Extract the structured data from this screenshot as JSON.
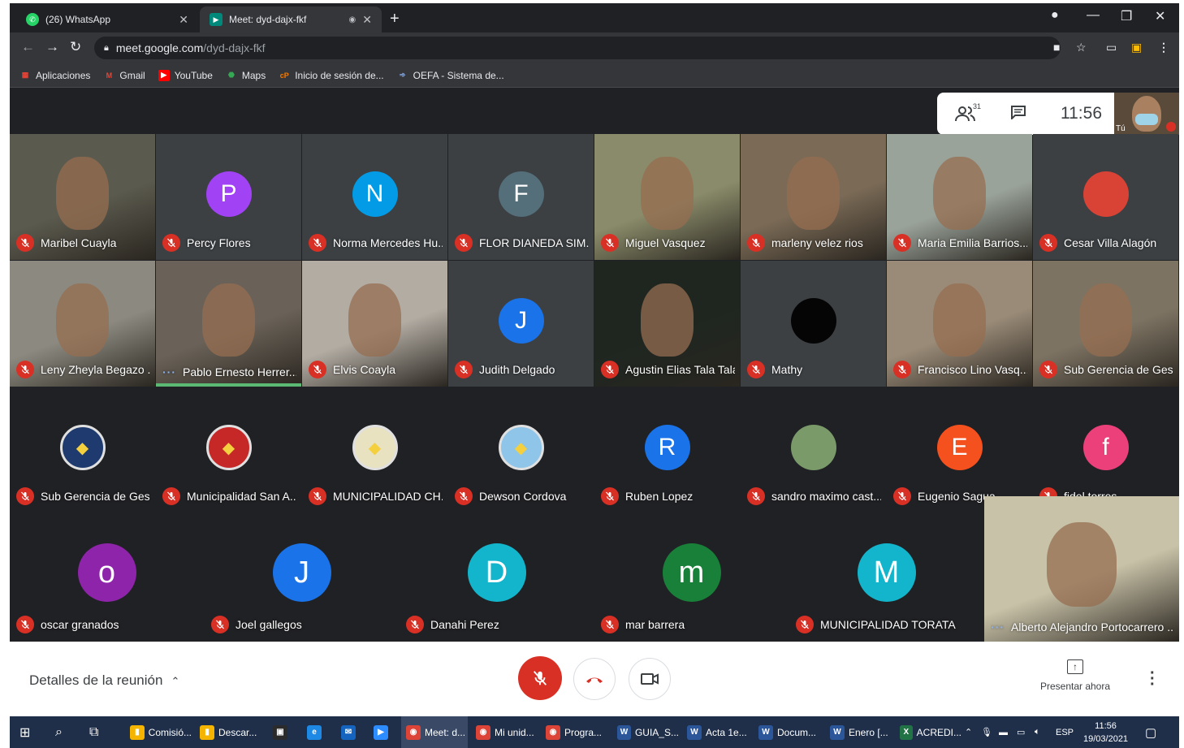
{
  "browser": {
    "tabs": [
      {
        "title": "(26) WhatsApp",
        "badge": "26",
        "icon": "whatsapp-icon",
        "color": "#25d366",
        "active": false
      },
      {
        "title": "Meet: dyd-dajx-fkf",
        "icon": "meet-icon",
        "color": "#00897b",
        "active": true
      }
    ],
    "url_host": "meet.google.com",
    "url_path": "/dyd-dajx-fkf",
    "bookmarks": [
      {
        "label": "Aplicaciones",
        "icon": "apps-grid-icon",
        "color": "#ea4335"
      },
      {
        "label": "Gmail",
        "icon": "gmail-icon",
        "color": "#ea4335"
      },
      {
        "label": "YouTube",
        "icon": "youtube-icon",
        "color": "#ff0000"
      },
      {
        "label": "Maps",
        "icon": "maps-icon",
        "color": "#34a853"
      },
      {
        "label": "Inicio de sesión de...",
        "icon": "login-icon",
        "color": "#f57c00"
      },
      {
        "label": "OEFA - Sistema de...",
        "icon": "oefa-icon",
        "color": "#1a73e8"
      }
    ]
  },
  "meet": {
    "participant_count": "31",
    "clock": "11:56",
    "self_label": "Tú",
    "meeting_details": "Detalles de la reunión",
    "present_now": "Presentar ahora"
  },
  "participants": [
    {
      "name": "Maribel Cuayla",
      "kind": "video",
      "bg": "#5b5a4e",
      "mic": "muted"
    },
    {
      "name": "Percy Flores",
      "kind": "letter",
      "letter": "P",
      "color": "#a142f4",
      "mic": "muted"
    },
    {
      "name": "Norma Mercedes Hu...",
      "kind": "letter",
      "letter": "N",
      "color": "#039be5",
      "mic": "muted"
    },
    {
      "name": "FLOR DIANEDA SIM...",
      "kind": "letter",
      "letter": "F",
      "color": "#546e7a",
      "mic": "muted"
    },
    {
      "name": "Miguel Vasquez",
      "kind": "video",
      "bg": "#8a8b6a",
      "mic": "muted"
    },
    {
      "name": "marleny velez rios",
      "kind": "video",
      "bg": "#7a6a56",
      "mic": "muted"
    },
    {
      "name": "Maria Emilia Barrios...",
      "kind": "video",
      "bg": "#9aa39a",
      "mic": "muted"
    },
    {
      "name": "Cesar Villa Alagón",
      "kind": "photo",
      "color": "#d84335",
      "mic": "muted"
    },
    {
      "name": "Leny Zheyla Begazo ...",
      "kind": "video",
      "bg": "#8c8a80",
      "mic": "muted"
    },
    {
      "name": "Pablo Ernesto Herrer...",
      "kind": "video",
      "bg": "#6a6258",
      "mic": "speaking"
    },
    {
      "name": "Elvis Coayla",
      "kind": "video",
      "bg": "#b2aca3",
      "mic": "muted"
    },
    {
      "name": "Judith Delgado",
      "kind": "letter",
      "letter": "J",
      "color": "#1a73e8",
      "mic": "muted"
    },
    {
      "name": "Agustin Elias Tala Tala",
      "kind": "video",
      "bg": "#1f2620",
      "mic": "muted"
    },
    {
      "name": "Mathy",
      "kind": "photo",
      "color": "#050505",
      "mic": "muted"
    },
    {
      "name": "Francisco Lino Vasq...",
      "kind": "video",
      "bg": "#9a8b78",
      "mic": "muted"
    },
    {
      "name": "Sub Gerencia de Ges...",
      "kind": "video",
      "bg": "#7d7363",
      "mic": "muted"
    },
    {
      "name": "Sub Gerencia de Ges...",
      "kind": "logo",
      "color": "#1e3a6e",
      "mic": "muted"
    },
    {
      "name": "Municipalidad San A...",
      "kind": "logo",
      "color": "#c62828",
      "mic": "muted"
    },
    {
      "name": "MUNICIPALIDAD CH...",
      "kind": "logo",
      "color": "#e8e2c0",
      "mic": "muted"
    },
    {
      "name": "Dewson Cordova",
      "kind": "logo",
      "color": "#8ec5e8",
      "mic": "muted"
    },
    {
      "name": "Ruben Lopez",
      "kind": "letter",
      "letter": "R",
      "color": "#1a73e8",
      "mic": "muted"
    },
    {
      "name": "sandro maximo cast...",
      "kind": "photo",
      "color": "#7a9a6a",
      "mic": "muted"
    },
    {
      "name": "Eugenio Sagua",
      "kind": "letter",
      "letter": "E",
      "color": "#f4511e",
      "mic": "muted"
    },
    {
      "name": "fidel torres",
      "kind": "letter",
      "letter": "f",
      "color": "#ec407a",
      "mic": "muted"
    },
    {
      "name": "oscar granados",
      "kind": "letter",
      "letter": "o",
      "color": "#8e24aa",
      "mic": "muted"
    },
    {
      "name": "Joel gallegos",
      "kind": "letter",
      "letter": "J",
      "color": "#1a73e8",
      "mic": "muted"
    },
    {
      "name": "Danahi Perez",
      "kind": "letter",
      "letter": "D",
      "color": "#12b5cb",
      "mic": "muted"
    },
    {
      "name": "mar barrera",
      "kind": "letter",
      "letter": "m",
      "color": "#188038",
      "mic": "muted"
    },
    {
      "name": "MUNICIPALIDAD TORATA",
      "kind": "letter",
      "letter": "M",
      "color": "#12b5cb",
      "mic": "muted"
    },
    {
      "name": "Alberto Alejandro Portocarrero ...",
      "kind": "video",
      "bg": "#c8c2a8",
      "mic": "speaking"
    }
  ],
  "taskbar": {
    "items": [
      {
        "label": "Comisió...",
        "icon": "folder-icon",
        "color": "#f4b400"
      },
      {
        "label": "Descar...",
        "icon": "folder-icon",
        "color": "#f4b400"
      },
      {
        "label": "",
        "icon": "store-icon",
        "color": "#2b2b2b"
      },
      {
        "label": "",
        "icon": "edge-icon",
        "color": "#1e88e5"
      },
      {
        "label": "",
        "icon": "mail-icon",
        "color": "#1565c0"
      },
      {
        "label": "",
        "icon": "zoom-icon",
        "color": "#2d8cff"
      },
      {
        "label": "Meet: d...",
        "icon": "chrome-icon",
        "color": "#db4437"
      },
      {
        "label": "Mi unid...",
        "icon": "chrome-icon",
        "color": "#db4437"
      },
      {
        "label": "Progra...",
        "icon": "chrome-icon",
        "color": "#db4437"
      },
      {
        "label": "GUIA_S...",
        "icon": "word-icon",
        "color": "#2b579a"
      },
      {
        "label": "Acta 1e...",
        "icon": "word-icon",
        "color": "#2b579a"
      },
      {
        "label": "Docum...",
        "icon": "word-icon",
        "color": "#2b579a"
      },
      {
        "label": "Enero [...",
        "icon": "word-icon",
        "color": "#2b579a"
      },
      {
        "label": "ACREDI...",
        "icon": "excel-icon",
        "color": "#217346"
      }
    ],
    "lang": "ESP",
    "time": "11:56",
    "date": "19/03/2021"
  }
}
